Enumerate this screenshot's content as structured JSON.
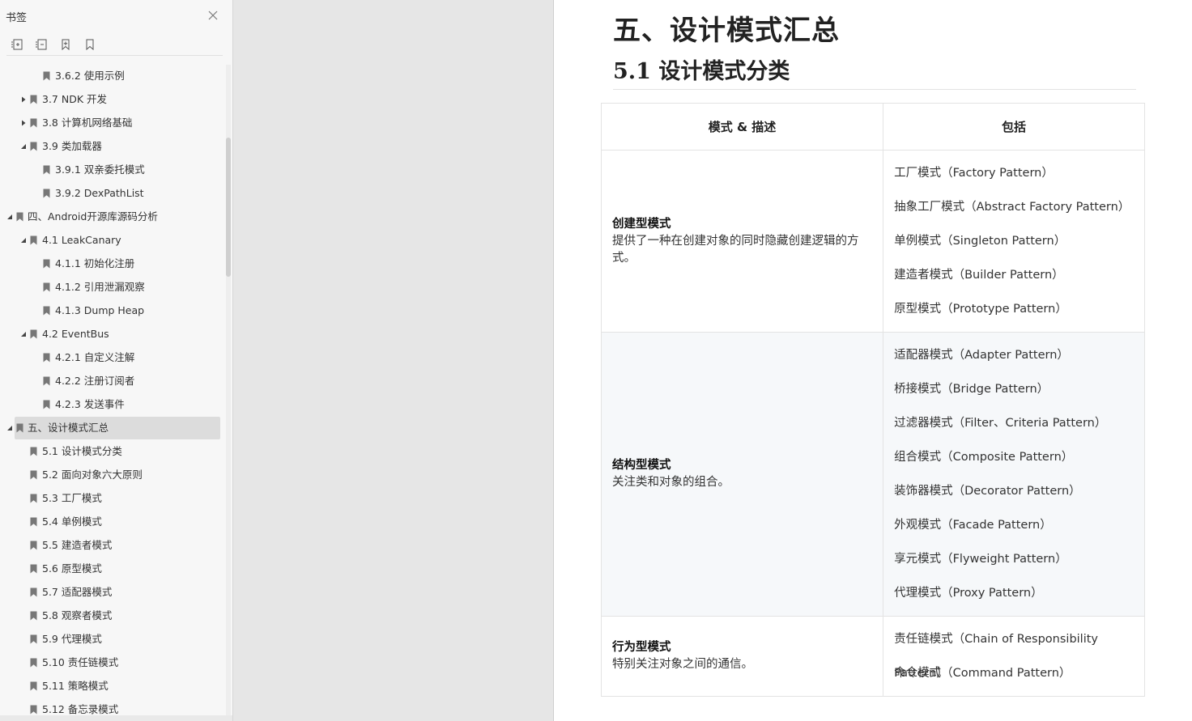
{
  "sidebar": {
    "title": "书签",
    "toolbar": [
      {
        "icon": "expand-all-icon"
      },
      {
        "icon": "collapse-all-icon"
      },
      {
        "icon": "add-bookmark-icon"
      },
      {
        "icon": "bookmark-icon"
      }
    ],
    "items": [
      {
        "label": "3.6.2 使用示例",
        "level": 2,
        "caret": "none"
      },
      {
        "label": "3.7 NDK 开发",
        "level": 1,
        "caret": "collapsed"
      },
      {
        "label": "3.8 计算机网络基础",
        "level": 1,
        "caret": "collapsed"
      },
      {
        "label": "3.9 类加载器",
        "level": 1,
        "caret": "expanded"
      },
      {
        "label": "3.9.1 双亲委托模式",
        "level": 2,
        "caret": "none"
      },
      {
        "label": "3.9.2 DexPathList",
        "level": 2,
        "caret": "none"
      },
      {
        "label": "四、Android开源库源码分析",
        "level": 0,
        "caret": "expanded"
      },
      {
        "label": "4.1 LeakCanary",
        "level": 1,
        "caret": "expanded"
      },
      {
        "label": "4.1.1 初始化注册",
        "level": 2,
        "caret": "none"
      },
      {
        "label": "4.1.2 引用泄漏观察",
        "level": 2,
        "caret": "none"
      },
      {
        "label": "4.1.3 Dump Heap",
        "level": 2,
        "caret": "none"
      },
      {
        "label": "4.2 EventBus",
        "level": 1,
        "caret": "expanded"
      },
      {
        "label": "4.2.1 自定义注解",
        "level": 2,
        "caret": "none"
      },
      {
        "label": "4.2.2 注册订阅者",
        "level": 2,
        "caret": "none"
      },
      {
        "label": "4.2.3 发送事件",
        "level": 2,
        "caret": "none"
      },
      {
        "label": "五、设计模式汇总",
        "level": 0,
        "caret": "expanded",
        "selected": true
      },
      {
        "label": "5.1 设计模式分类",
        "level": 1,
        "caret": "none"
      },
      {
        "label": "5.2 面向对象六大原则",
        "level": 1,
        "caret": "none"
      },
      {
        "label": "5.3 工厂模式",
        "level": 1,
        "caret": "none"
      },
      {
        "label": "5.4 单例模式",
        "level": 1,
        "caret": "none"
      },
      {
        "label": "5.5 建造者模式",
        "level": 1,
        "caret": "none"
      },
      {
        "label": "5.6 原型模式",
        "level": 1,
        "caret": "none"
      },
      {
        "label": "5.7 适配器模式",
        "level": 1,
        "caret": "none"
      },
      {
        "label": "5.8 观察者模式",
        "level": 1,
        "caret": "none"
      },
      {
        "label": "5.9 代理模式",
        "level": 1,
        "caret": "none"
      },
      {
        "label": "5.10 责任链模式",
        "level": 1,
        "caret": "none"
      },
      {
        "label": "5.11 策略模式",
        "level": 1,
        "caret": "none"
      },
      {
        "label": "5.12 备忘录模式",
        "level": 1,
        "caret": "none"
      }
    ]
  },
  "document": {
    "heading1": "五、设计模式汇总",
    "heading2": "5.1  设计模式分类",
    "table": {
      "headers": [
        "模式 & 描述",
        "包括"
      ],
      "rows": [
        {
          "name": "创建型模式",
          "description": "提供了一种在创建对象的同时隐藏创建逻辑的方式。",
          "patterns": [
            "工厂模式（Factory Pattern）",
            "抽象工厂模式（Abstract Factory Pattern）",
            "单例模式（Singleton Pattern）",
            "建造者模式（Builder Pattern）",
            "原型模式（Prototype Pattern）"
          ]
        },
        {
          "name": "结构型模式",
          "description": "关注类和对象的组合。",
          "patterns": [
            "适配器模式（Adapter Pattern）",
            "桥接模式（Bridge Pattern）",
            "过滤器模式（Filter、Criteria Pattern）",
            "组合模式（Composite Pattern）",
            "装饰器模式（Decorator Pattern）",
            "外观模式（Facade Pattern）",
            "享元模式（Flyweight Pattern）",
            "代理模式（Proxy Pattern）"
          ]
        },
        {
          "name": "行为型模式",
          "description": "特别关注对象之间的通信。",
          "patterns": [
            "责任链模式（Chain of Responsibility Pattern）",
            "命令模式（Command Pattern）"
          ]
        }
      ]
    }
  }
}
